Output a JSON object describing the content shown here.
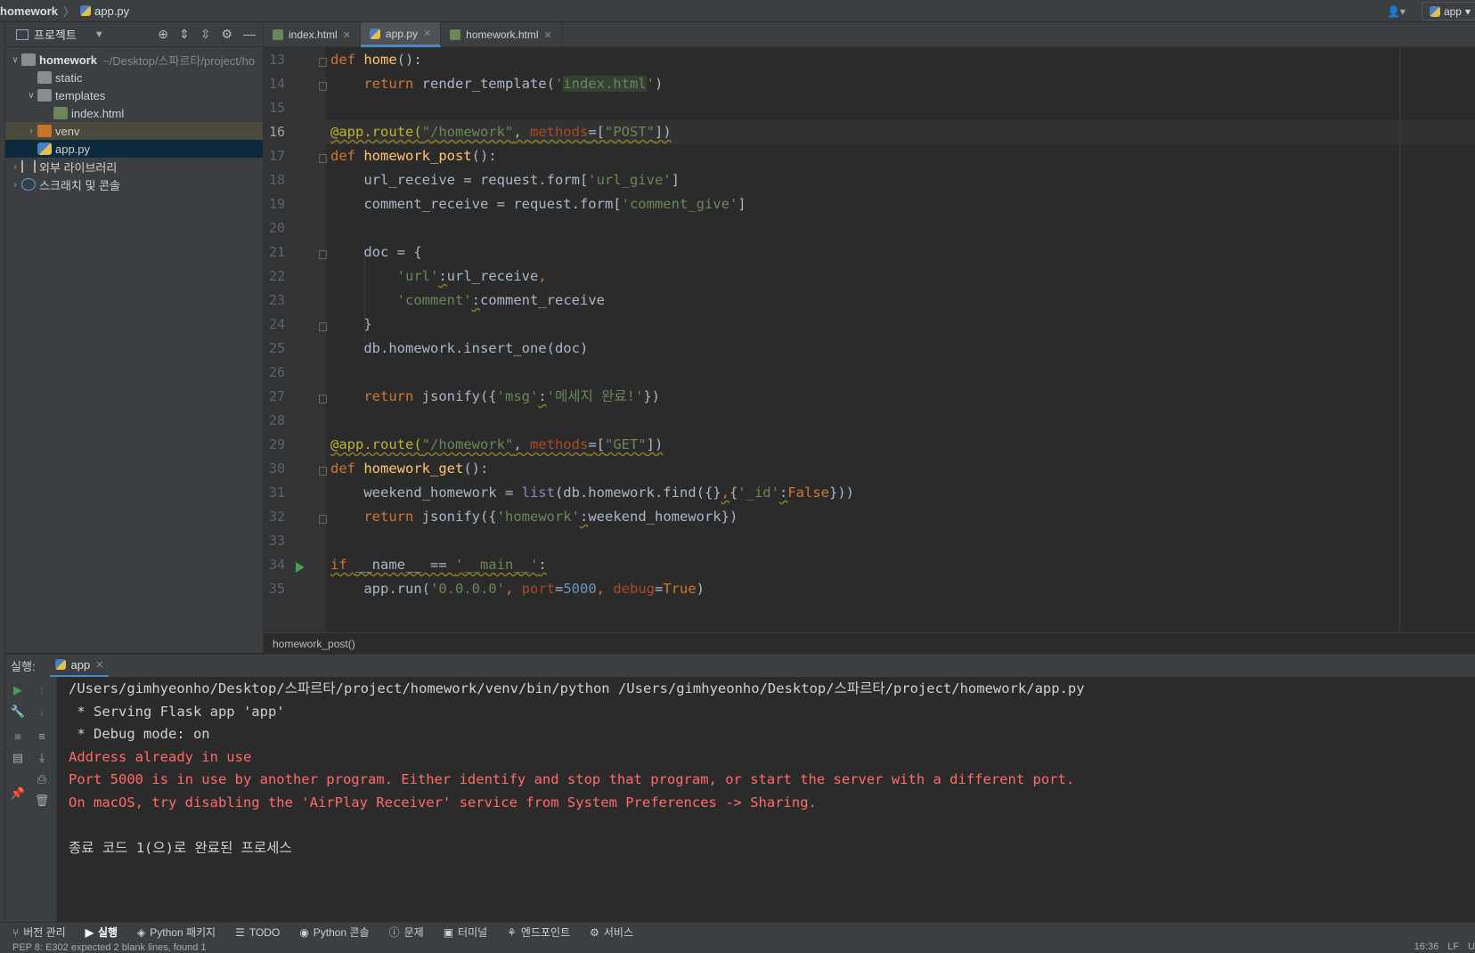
{
  "titlebar": {
    "project": "homework",
    "file": "app.py",
    "run_config": "app"
  },
  "project_panel": {
    "title": "프로젝트",
    "root": {
      "name": "homework",
      "path": "~/Desktop/스파르타/project/ho"
    },
    "items": [
      {
        "label": "static"
      },
      {
        "label": "templates"
      },
      {
        "label": "index.html"
      },
      {
        "label": "venv"
      },
      {
        "label": "app.py"
      },
      {
        "label": "외부 라이브러리"
      },
      {
        "label": "스크래치 및 콘솔"
      }
    ]
  },
  "tabs": [
    {
      "label": "index.html"
    },
    {
      "label": "app.py"
    },
    {
      "label": "homework.html"
    }
  ],
  "editor": {
    "line_numbers": [
      "13",
      "14",
      "15",
      "16",
      "17",
      "18",
      "19",
      "20",
      "21",
      "22",
      "23",
      "24",
      "25",
      "26",
      "27",
      "28",
      "29",
      "30",
      "31",
      "32",
      "33",
      "34",
      "35"
    ],
    "current_line": "16",
    "breadcrumb": "homework_post()"
  },
  "run_window": {
    "label": "실행:",
    "tab": "app",
    "console": [
      "/Users/gimhyeonho/Desktop/스파르타/project/homework/venv/bin/python /Users/gimhyeonho/Desktop/스파르타/project/homework/app.py",
      " * Serving Flask app 'app'",
      " * Debug mode: on",
      "Address already in use",
      "Port 5000 is in use by another program. Either identify and stop that program, or start the server with a different port.",
      "On macOS, try disabling the 'AirPlay Receiver' service from System Preferences -> Sharing.",
      "종료 코드 1(으)로 완료된 프로세스"
    ]
  },
  "toolstrip": [
    {
      "label": "버전 관리"
    },
    {
      "label": "실행"
    },
    {
      "label": "Python 패키지"
    },
    {
      "label": "TODO"
    },
    {
      "label": "Python 콘솔"
    },
    {
      "label": "문제"
    },
    {
      "label": "터미널"
    },
    {
      "label": "엔드포인트"
    },
    {
      "label": "서비스"
    }
  ],
  "statusbar": {
    "message": "PEP 8: E302 expected 2 blank lines, found 1",
    "time": "16:36",
    "line_sep": "LF",
    "encoding": "U"
  }
}
